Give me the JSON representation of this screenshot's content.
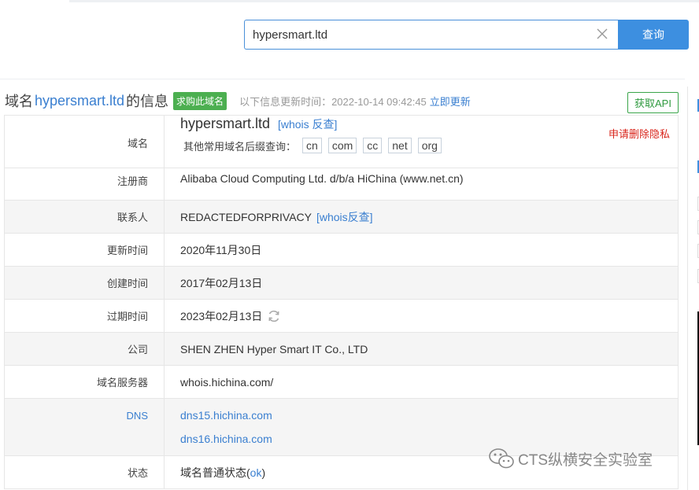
{
  "search": {
    "value": "hypersmart.ltd",
    "button": "查询"
  },
  "heading": {
    "prefix": "域名",
    "domain": "hypersmart.ltd",
    "suffix": "的信息",
    "buy_badge": "求购此域名",
    "updated_label": "以下信息更新时间：2022-10-14 09:42:45",
    "refresh_link": "立即更新",
    "api_button": "获取API"
  },
  "rows": {
    "domain": {
      "label": "域名",
      "value": "hypersmart.ltd",
      "whois_link": "[whois 反查]",
      "privacy_link": "申请删除隐私",
      "suffix_label": "其他常用域名后缀查询：",
      "suffixes": [
        "cn",
        "com",
        "cc",
        "net",
        "org"
      ]
    },
    "registrar": {
      "label": "注册商",
      "value": "Alibaba Cloud Computing Ltd. d/b/a HiChina (www.net.cn)"
    },
    "contact": {
      "label": "联系人",
      "value": "REDACTEDFORPRIVACY",
      "link": "[whois反查]"
    },
    "updated": {
      "label": "更新时间",
      "value": "2020年11月30日"
    },
    "created": {
      "label": "创建时间",
      "value": "2017年02月13日"
    },
    "expires": {
      "label": "过期时间",
      "value": "2023年02月13日"
    },
    "company": {
      "label": "公司",
      "value": "SHEN ZHEN Hyper Smart IT Co., LTD"
    },
    "whois_server": {
      "label": "域名服务器",
      "value": "whois.hichina.com/"
    },
    "dns": {
      "label": "DNS",
      "servers": [
        "dns15.hichina.com",
        "dns16.hichina.com"
      ]
    },
    "status": {
      "label": "状态",
      "prefix": "域名普通状态(",
      "link": "ok",
      "suffix": ")"
    }
  },
  "watermark": {
    "text": "CTS纵横安全实验室"
  },
  "colors": {
    "accent": "#3d8fe0",
    "link": "#3a7fd0",
    "badge": "#4caf50",
    "danger": "#d9261c"
  }
}
